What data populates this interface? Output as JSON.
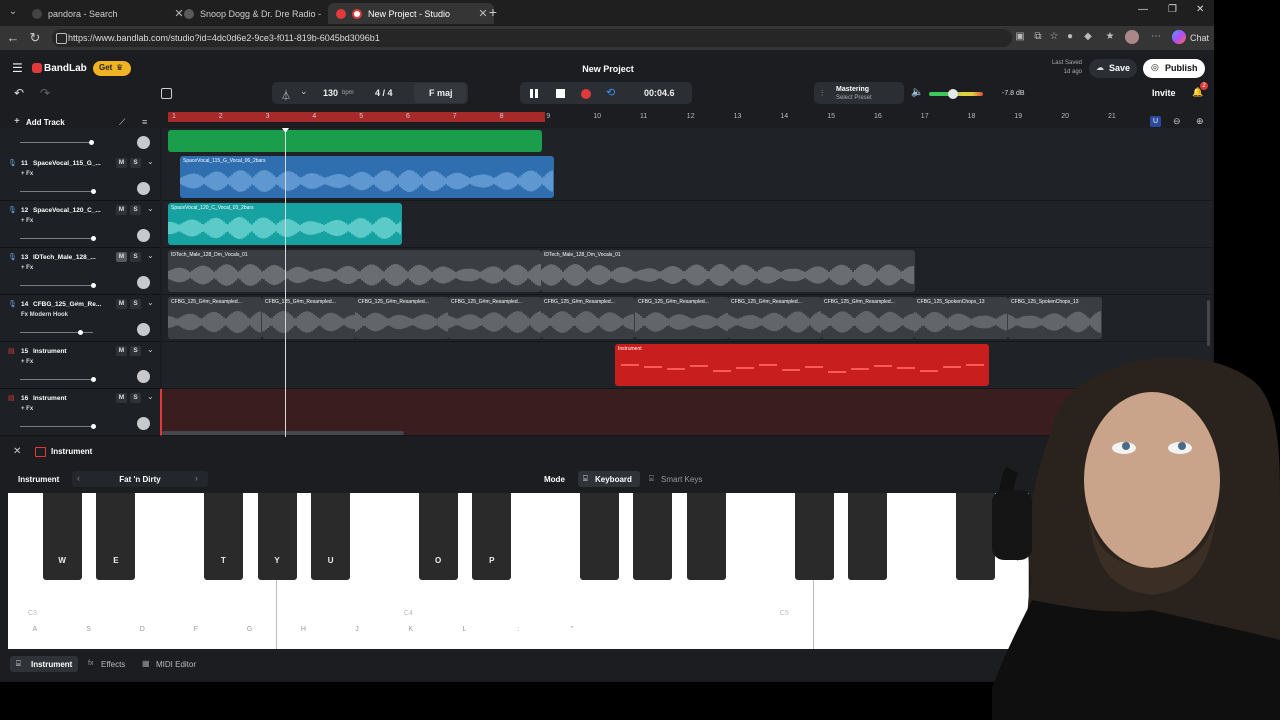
{
  "browser": {
    "tabs": [
      {
        "label": "pandora - Search",
        "active": false
      },
      {
        "label": "Snoop Dogg & Dr. Dre Radio - No",
        "active": false
      },
      {
        "label": "New Project - Studio",
        "active": true
      }
    ],
    "url": "https://www.bandlab.com/studio?id=4dc0d6e2-9ce3-f011-819b-6045bd3096b1",
    "chat_label": "Chat"
  },
  "app": {
    "logo": "BandLab",
    "get_label": "Get",
    "project_title": "New Project",
    "last_saved_label": "Last Saved",
    "last_saved_value": "1d ago",
    "save_label": "Save",
    "publish_label": "Publish",
    "invite_label": "Invite",
    "notification_count": "2"
  },
  "toolbar": {
    "tempo": "130",
    "tempo_unit": "bpm",
    "time_signature": "4 / 4",
    "key": "F maj",
    "time": "00:04.6",
    "mastering_label": "Mastering",
    "mastering_preset": "Select Preset",
    "db_value": "-7.8 dB",
    "add_track_label": "Add Track"
  },
  "ruler": {
    "ticks": [
      "1",
      "2",
      "3",
      "4",
      "5",
      "6",
      "7",
      "8",
      "9",
      "10",
      "11",
      "12",
      "13",
      "14",
      "15",
      "16",
      "17",
      "18",
      "19",
      "20",
      "21"
    ]
  },
  "tracks": [
    {
      "num": "11",
      "name": "SpaceVocal_115_G_...",
      "fx": "+ Fx",
      "icon": "mic-icon",
      "clips": [
        {
          "label": "SpaceVocal_115_G_Vocal_06_2bars"
        }
      ]
    },
    {
      "num": "12",
      "name": "SpaceVocal_120_C_...",
      "fx": "+ Fx",
      "icon": "mic-icon",
      "clips": [
        {
          "label": "SpaceVocal_120_C_Vocal_03_2bars"
        }
      ]
    },
    {
      "num": "13",
      "name": "IDTech_Male_128_...",
      "fx": "+ Fx",
      "icon": "mic-icon",
      "clips": [
        {
          "label": "IDTech_Male_128_Dm_Vocals_01"
        },
        {
          "label": "IDTech_Male_128_Dm_Vocals_01"
        }
      ]
    },
    {
      "num": "14",
      "name": "CFBG_125_G#m_Re...",
      "fx": "Fx Modern Hook",
      "icon": "mic-icon",
      "clips": [
        {
          "label": "CFBG_125_G#m_Resampled..."
        },
        {
          "label": "CFBG_125_G#m_Resampled..."
        },
        {
          "label": "CFBG_125_G#m_Resampled..."
        },
        {
          "label": "CFBG_125_G#m_Resampled..."
        },
        {
          "label": "CFBG_125_G#m_Resampled..."
        },
        {
          "label": "CFBG_125_G#m_Resampled..."
        },
        {
          "label": "CFBG_125_G#m_Resampled..."
        },
        {
          "label": "CFBG_125_G#m_Resampled..."
        },
        {
          "label": "CFBG_125_SpokenChops_13"
        },
        {
          "label": "CFBG_125_SpokenChops_13"
        }
      ]
    },
    {
      "num": "15",
      "name": "Instrument",
      "fx": "+ Fx",
      "icon": "keyboard-icon",
      "clips": [
        {
          "label": "Instrument"
        }
      ]
    },
    {
      "num": "16",
      "name": "Instrument",
      "fx": "+ Fx",
      "icon": "keyboard-icon",
      "clips": []
    }
  ],
  "instrument_panel": {
    "title": "Instrument",
    "instrument_label": "Instrument",
    "preset": "Fat 'n Dirty",
    "mode_label": "Mode",
    "keyboard_label": "Keyboard",
    "smart_keys_label": "Smart Keys",
    "octave_labels": [
      "C3",
      "C4",
      "C5"
    ],
    "white_key_labels": [
      "A",
      "S",
      "D",
      "F",
      "G",
      "H",
      "J",
      "K",
      "L",
      ":",
      "\""
    ],
    "black_key_labels": [
      "W",
      "E",
      "T",
      "Y",
      "U",
      "O",
      "P"
    ],
    "bottom_tabs": [
      "Instrument",
      "Effects",
      "MIDI Editor"
    ]
  },
  "colors": {
    "accent_red": "#e03a3a",
    "green_clip": "#1a9e4c",
    "blue_clip": "#2f6fb0",
    "teal_clip": "#17a2a2",
    "gray_clip": "#55585d",
    "midi_red": "#c81e1e",
    "get_badge": "#f0b323"
  }
}
